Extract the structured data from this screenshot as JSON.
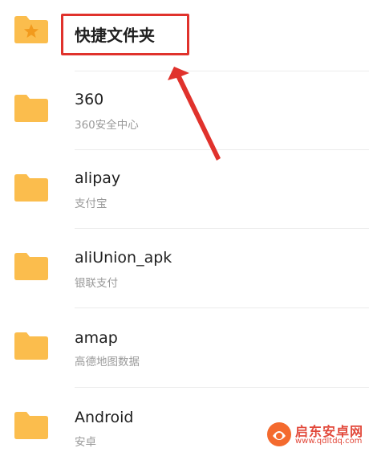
{
  "folders": [
    {
      "name": "快捷文件夹",
      "subtitle": "",
      "icon": "folder-star-icon",
      "highlighted": true
    },
    {
      "name": "360",
      "subtitle": "360安全中心",
      "icon": "folder-icon"
    },
    {
      "name": "alipay",
      "subtitle": "支付宝",
      "icon": "folder-icon"
    },
    {
      "name": "aliUnion_apk",
      "subtitle": "银联支付",
      "icon": "folder-icon"
    },
    {
      "name": "amap",
      "subtitle": "高德地图数据",
      "icon": "folder-icon"
    },
    {
      "name": "Android",
      "subtitle": "安卓",
      "icon": "folder-icon"
    }
  ],
  "colors": {
    "folder": "#fbbd4d",
    "folder_tab": "#f7ad32",
    "annotation": "#e0322c"
  },
  "watermark": {
    "name": "启东安卓网",
    "url": "www.qdltdq.com"
  }
}
